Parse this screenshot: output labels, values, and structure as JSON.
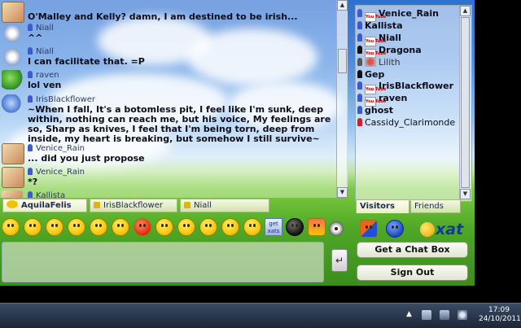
{
  "messages": [
    {
      "user": "Venice_Rain",
      "text": "O'Malley and Kelly? damn, I am destined to be irish..."
    },
    {
      "user": "Niall",
      "text": "^^"
    },
    {
      "user": "Niall",
      "text": "I can facilitate that. =P"
    },
    {
      "user": "raven",
      "text": "lol ven"
    },
    {
      "user": "IrisBlackflower",
      "text": "~When I fall, It's a botomless pit, I feel like I'm sunk, deep within, nothing can reach me, but his voice, My feelings are so, Sharp as knives, I feel that I'm being torn, deep from inside, my heart is breaking, but somehow I still survive~"
    },
    {
      "user": "Venice_Rain",
      "text": "... did you just propose"
    },
    {
      "user": "Venice_Rain",
      "text": "*?"
    },
    {
      "user": "Kallista",
      "text": ""
    }
  ],
  "users": [
    {
      "name": "Venice_Rain",
      "color": "#3b5bd6",
      "badge": "You Tube"
    },
    {
      "name": "Kallista",
      "color": "#3b5bd6",
      "badge": ""
    },
    {
      "name": "Niall",
      "color": "#3b5bd6",
      "badge": "You Tube"
    },
    {
      "name": "Dragona",
      "color": "#111111",
      "badge": "You Tube"
    },
    {
      "name": "Lilith",
      "color": "#555555",
      "badge": "lizard"
    },
    {
      "name": "Gep",
      "color": "#111111",
      "badge": ""
    },
    {
      "name": "IrisBlackflower",
      "color": "#3b5bd6",
      "badge": "You Tube"
    },
    {
      "name": "raven",
      "color": "#3b5bd6",
      "badge": "You Tube"
    },
    {
      "name": "ghost",
      "color": "#3b5bd6",
      "badge": ""
    },
    {
      "name": "Cassidy_Clarimonde",
      "color": "#d02020",
      "badge": ""
    }
  ],
  "tabs": {
    "main": "AquilaFelis",
    "pm1": "IrisBlackflower",
    "pm2": "Niall"
  },
  "userlist_tabs": {
    "visitors": "Visitors",
    "friends": "Friends"
  },
  "smileys": [
    "smile-icon",
    "biggrin-icon",
    "wink-icon",
    "surprised-icon",
    "tongue-icon",
    "cool-icon",
    "mad-icon",
    "confused-icon",
    "blush-icon",
    "sad-icon",
    "crying-icon",
    "smile2-icon"
  ],
  "get_xats": "get xats",
  "logo": "xat",
  "buttons": {
    "get_chat_box": "Get a Chat Box",
    "sign_out": "Sign Out",
    "send": "↵"
  },
  "taskbar": {
    "time": "17:09",
    "date": "24/10/2011"
  }
}
